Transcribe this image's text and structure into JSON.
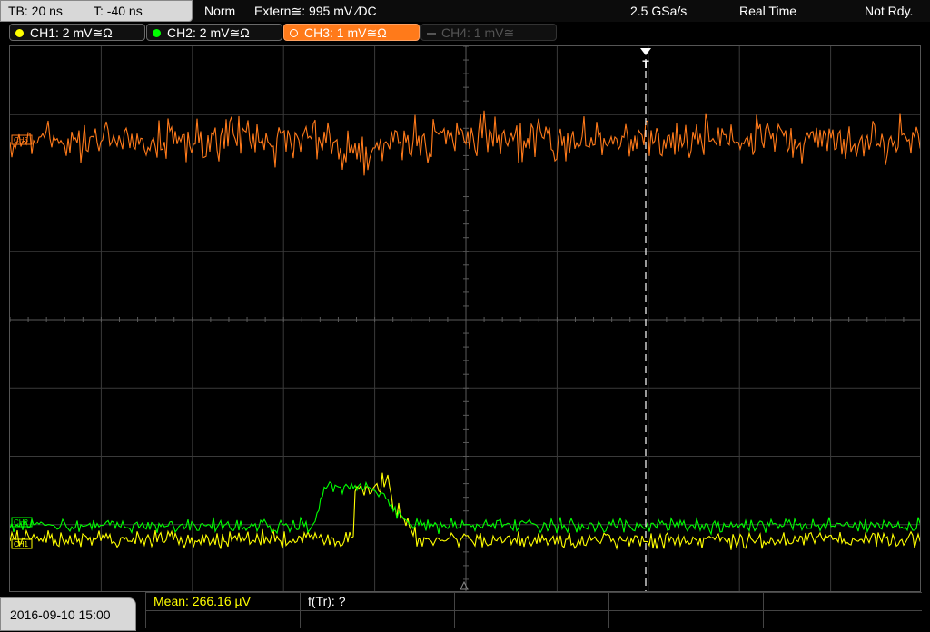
{
  "timebase": {
    "tb_label": "TB: 20 ns",
    "t_label": "T: -40 ns"
  },
  "acquisition": {
    "mode": "Norm",
    "trigger": "Extern≅: 995 mV ⁄DC",
    "sample_rate": "2.5 GSa/s",
    "realtime": "Real Time",
    "status": "Not Rdy."
  },
  "channels": [
    {
      "label": "CH1: 2 mV≅Ω",
      "color": "#ffff00"
    },
    {
      "label": "CH2: 2 mV≅Ω",
      "color": "#00ff00"
    },
    {
      "label": "CH3: 1 mV≅Ω",
      "color": "#ff7a1a"
    },
    {
      "label": "CH4: 1 mV≅",
      "color": "#555555"
    }
  ],
  "markers": {
    "trigger_marker": "T",
    "ch3_marker": "CH3",
    "ch2_marker": "CH2",
    "ch1_marker": "CH1"
  },
  "footer": {
    "datetime": "2016-09-10 15:00",
    "mean": "Mean: 266.16 µV",
    "ftr": "f(Tr): ?"
  }
}
